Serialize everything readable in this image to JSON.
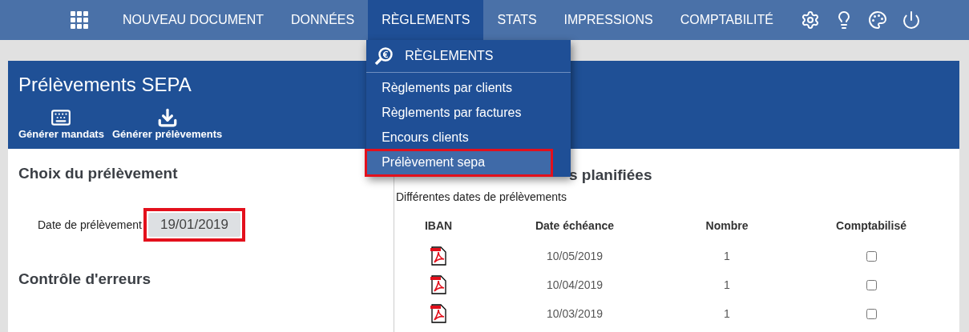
{
  "nav": {
    "items": [
      {
        "label": "NOUVEAU DOCUMENT",
        "selected": false
      },
      {
        "label": "DONNÉES",
        "selected": false
      },
      {
        "label": "RÈGLEMENTS",
        "selected": true
      },
      {
        "label": "STATS",
        "selected": false
      },
      {
        "label": "IMPRESSIONS",
        "selected": false
      },
      {
        "label": "COMPTABILITÉ",
        "selected": false
      }
    ]
  },
  "dropdown": {
    "title": "RÈGLEMENTS",
    "items": [
      {
        "label": "Règlements par clients",
        "selected": false,
        "highlighted": false
      },
      {
        "label": "Règlements par factures",
        "selected": false,
        "highlighted": false
      },
      {
        "label": "Encours clients",
        "selected": false,
        "highlighted": false
      },
      {
        "label": "Prélèvement sepa",
        "selected": true,
        "highlighted": true
      }
    ]
  },
  "page": {
    "title": "Prélèvements SEPA",
    "toolbar": [
      {
        "kind": "mandates",
        "label": "Générer mandats"
      },
      {
        "kind": "download",
        "label": "Générer prélèvements"
      }
    ]
  },
  "left": {
    "heading": "Choix du prélèvement",
    "date_label": "Date de prélèvement",
    "date_value": "19/01/2019",
    "date_highlighted": true,
    "errors_heading": "Contrôle d'erreurs"
  },
  "right": {
    "heading": "s planifiées",
    "subtitle": "Différentes dates de prélèvements",
    "columns": [
      "IBAN",
      "Date échéance",
      "Nombre",
      "Comptabilisé"
    ],
    "rows": [
      {
        "date": "10/05/2019",
        "count": "1",
        "checked": false
      },
      {
        "date": "10/04/2019",
        "count": "1",
        "checked": false
      },
      {
        "date": "10/03/2019",
        "count": "1",
        "checked": false
      }
    ]
  }
}
